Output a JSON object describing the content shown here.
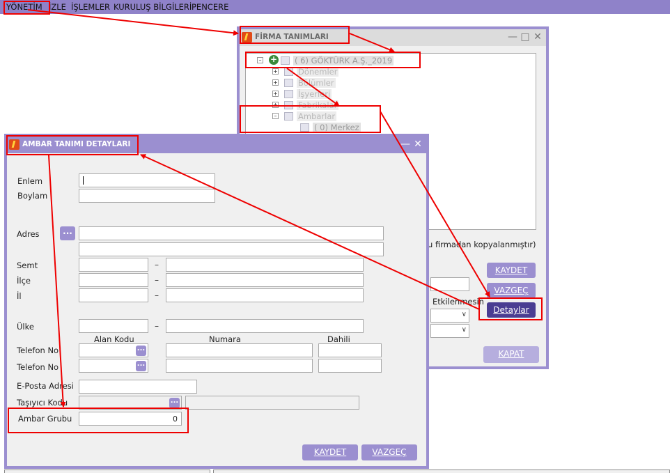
{
  "menubar": {
    "items": [
      "YÖNETİM",
      "İZLE",
      "İŞLEMLER",
      "KURULUŞ BİLGİLERİ",
      "PENCERE"
    ]
  },
  "firma_window": {
    "title": "FİRMA TANIMLARI",
    "tree": {
      "root": "(  6) GÖKTÜRK A.Ş._2019",
      "children": [
        "Dönemler",
        "Bölümler",
        "İşyerleri",
        "Fabrikalar",
        "Ambarlar"
      ],
      "ambar_child": "(    0) Merkez"
    },
    "copied_from_text": "u firmadan kopyalanmıştır)",
    "affected_text": "Etkilenmesin",
    "buttons": {
      "save": "KAYDET",
      "cancel": "VAZGEÇ",
      "details": "Detaylar",
      "close": "KAPAT"
    }
  },
  "ambar_window": {
    "title": "AMBAR TANIMI DETAYLARI",
    "fields": {
      "enlem": "Enlem",
      "boylam": "Boylam",
      "adres": "Adres",
      "semt": "Semt",
      "ilce": "İlçe",
      "il": "İl",
      "ulke": "Ülke",
      "telefon1": "Telefon No",
      "telefon2": "Telefon No",
      "eposta": "E-Posta Adresi",
      "tasiyici": "Taşıyıcı Kodu",
      "ambar_grubu": "Ambar Grubu"
    },
    "phone_headers": {
      "area": "Alan Kodu",
      "number": "Numara",
      "extension": "Dahili"
    },
    "dash": "–",
    "dots": "...",
    "ambar_grubu_value": "0",
    "buttons": {
      "save": "KAYDET",
      "cancel": "VAZGEÇ"
    }
  },
  "colors": {
    "accent": "#9b8fd0",
    "accent_dark": "#4a3d92",
    "annotation": "#ee0000",
    "logo": "#e14b16"
  }
}
